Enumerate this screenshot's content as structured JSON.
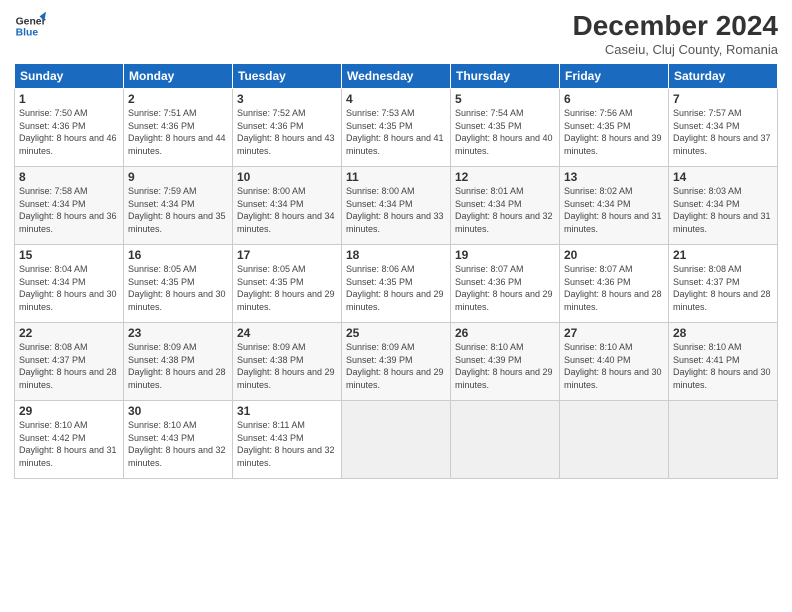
{
  "header": {
    "logo_line1": "General",
    "logo_line2": "Blue",
    "month": "December 2024",
    "location": "Caseiu, Cluj County, Romania"
  },
  "days_of_week": [
    "Sunday",
    "Monday",
    "Tuesday",
    "Wednesday",
    "Thursday",
    "Friday",
    "Saturday"
  ],
  "weeks": [
    [
      {
        "num": "1",
        "rise": "7:50 AM",
        "set": "4:36 PM",
        "daylight": "8 hours and 46 minutes."
      },
      {
        "num": "2",
        "rise": "7:51 AM",
        "set": "4:36 PM",
        "daylight": "8 hours and 44 minutes."
      },
      {
        "num": "3",
        "rise": "7:52 AM",
        "set": "4:36 PM",
        "daylight": "8 hours and 43 minutes."
      },
      {
        "num": "4",
        "rise": "7:53 AM",
        "set": "4:35 PM",
        "daylight": "8 hours and 41 minutes."
      },
      {
        "num": "5",
        "rise": "7:54 AM",
        "set": "4:35 PM",
        "daylight": "8 hours and 40 minutes."
      },
      {
        "num": "6",
        "rise": "7:56 AM",
        "set": "4:35 PM",
        "daylight": "8 hours and 39 minutes."
      },
      {
        "num": "7",
        "rise": "7:57 AM",
        "set": "4:34 PM",
        "daylight": "8 hours and 37 minutes."
      }
    ],
    [
      {
        "num": "8",
        "rise": "7:58 AM",
        "set": "4:34 PM",
        "daylight": "8 hours and 36 minutes."
      },
      {
        "num": "9",
        "rise": "7:59 AM",
        "set": "4:34 PM",
        "daylight": "8 hours and 35 minutes."
      },
      {
        "num": "10",
        "rise": "8:00 AM",
        "set": "4:34 PM",
        "daylight": "8 hours and 34 minutes."
      },
      {
        "num": "11",
        "rise": "8:00 AM",
        "set": "4:34 PM",
        "daylight": "8 hours and 33 minutes."
      },
      {
        "num": "12",
        "rise": "8:01 AM",
        "set": "4:34 PM",
        "daylight": "8 hours and 32 minutes."
      },
      {
        "num": "13",
        "rise": "8:02 AM",
        "set": "4:34 PM",
        "daylight": "8 hours and 31 minutes."
      },
      {
        "num": "14",
        "rise": "8:03 AM",
        "set": "4:34 PM",
        "daylight": "8 hours and 31 minutes."
      }
    ],
    [
      {
        "num": "15",
        "rise": "8:04 AM",
        "set": "4:34 PM",
        "daylight": "8 hours and 30 minutes."
      },
      {
        "num": "16",
        "rise": "8:05 AM",
        "set": "4:35 PM",
        "daylight": "8 hours and 30 minutes."
      },
      {
        "num": "17",
        "rise": "8:05 AM",
        "set": "4:35 PM",
        "daylight": "8 hours and 29 minutes."
      },
      {
        "num": "18",
        "rise": "8:06 AM",
        "set": "4:35 PM",
        "daylight": "8 hours and 29 minutes."
      },
      {
        "num": "19",
        "rise": "8:07 AM",
        "set": "4:36 PM",
        "daylight": "8 hours and 29 minutes."
      },
      {
        "num": "20",
        "rise": "8:07 AM",
        "set": "4:36 PM",
        "daylight": "8 hours and 28 minutes."
      },
      {
        "num": "21",
        "rise": "8:08 AM",
        "set": "4:37 PM",
        "daylight": "8 hours and 28 minutes."
      }
    ],
    [
      {
        "num": "22",
        "rise": "8:08 AM",
        "set": "4:37 PM",
        "daylight": "8 hours and 28 minutes."
      },
      {
        "num": "23",
        "rise": "8:09 AM",
        "set": "4:38 PM",
        "daylight": "8 hours and 28 minutes."
      },
      {
        "num": "24",
        "rise": "8:09 AM",
        "set": "4:38 PM",
        "daylight": "8 hours and 29 minutes."
      },
      {
        "num": "25",
        "rise": "8:09 AM",
        "set": "4:39 PM",
        "daylight": "8 hours and 29 minutes."
      },
      {
        "num": "26",
        "rise": "8:10 AM",
        "set": "4:39 PM",
        "daylight": "8 hours and 29 minutes."
      },
      {
        "num": "27",
        "rise": "8:10 AM",
        "set": "4:40 PM",
        "daylight": "8 hours and 30 minutes."
      },
      {
        "num": "28",
        "rise": "8:10 AM",
        "set": "4:41 PM",
        "daylight": "8 hours and 30 minutes."
      }
    ],
    [
      {
        "num": "29",
        "rise": "8:10 AM",
        "set": "4:42 PM",
        "daylight": "8 hours and 31 minutes."
      },
      {
        "num": "30",
        "rise": "8:10 AM",
        "set": "4:43 PM",
        "daylight": "8 hours and 32 minutes."
      },
      {
        "num": "31",
        "rise": "8:11 AM",
        "set": "4:43 PM",
        "daylight": "8 hours and 32 minutes."
      },
      null,
      null,
      null,
      null
    ]
  ]
}
